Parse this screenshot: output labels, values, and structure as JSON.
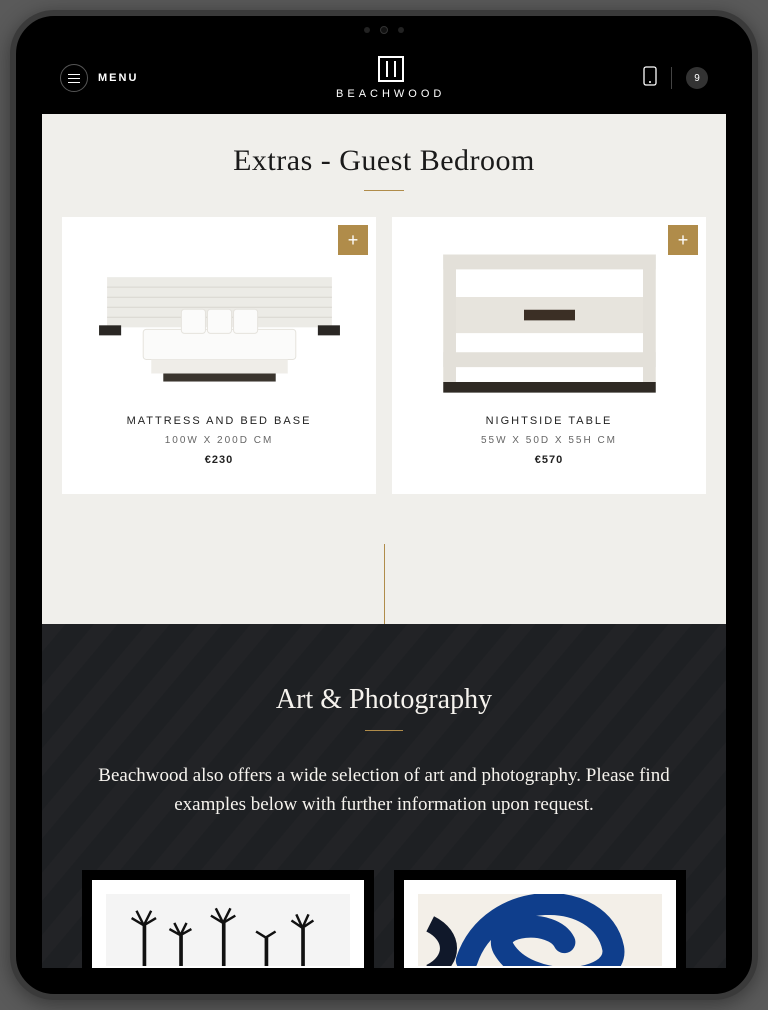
{
  "header": {
    "menu_label": "MENU",
    "brand_name": "BEACHWOOD",
    "cart_count": "9"
  },
  "extras": {
    "title": "Extras - Guest Bedroom",
    "products": [
      {
        "name": "MATTRESS AND BED BASE",
        "dimensions": "100W X 200D CM",
        "price": "€230",
        "add_icon": "+"
      },
      {
        "name": "NIGHTSIDE TABLE",
        "dimensions": "55W X 50D X 55H CM",
        "price": "€570",
        "add_icon": "+"
      }
    ]
  },
  "art": {
    "title": "Art & Photography",
    "copy": "Beachwood also offers a wide selection of art and photography. Please find examples below with further information upon request."
  }
}
